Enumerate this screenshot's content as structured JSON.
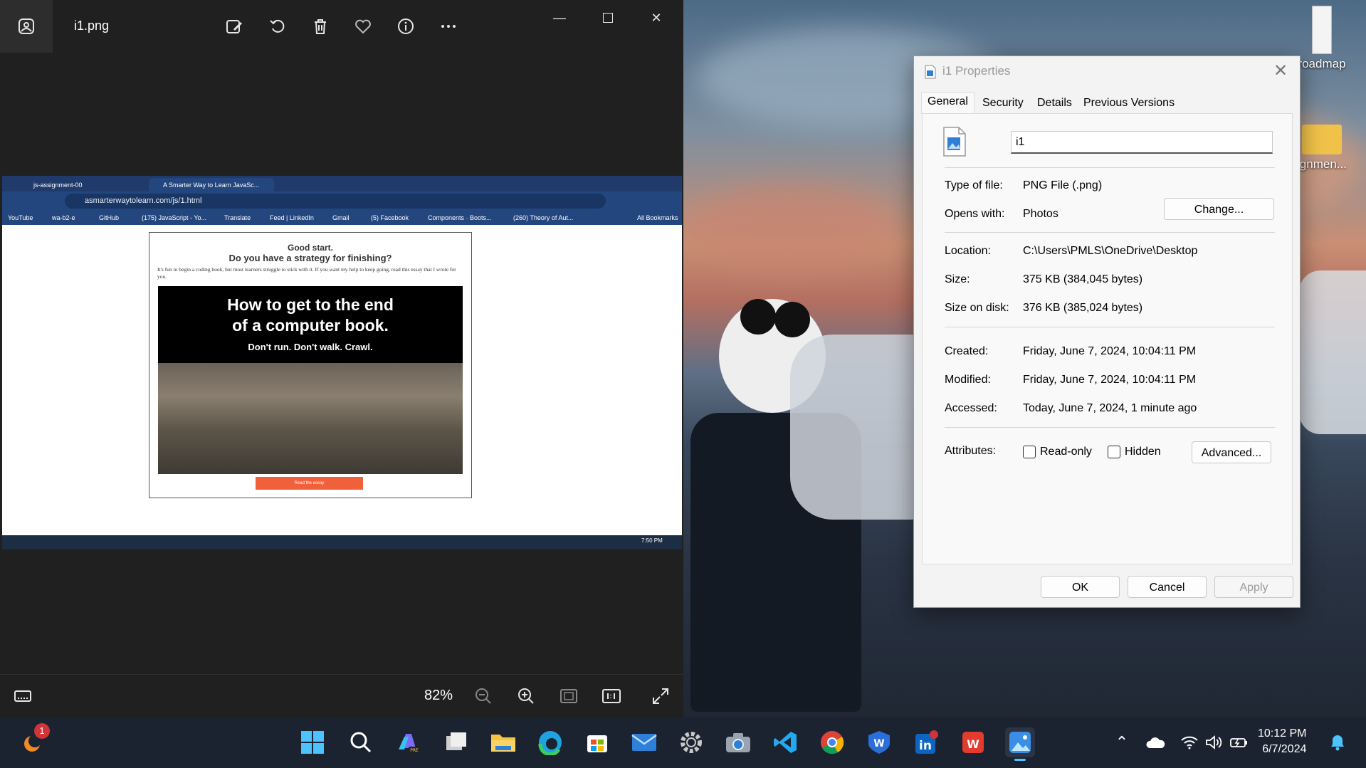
{
  "photos_window": {
    "filename": "i1.png",
    "zoom": "82%"
  },
  "inner_screenshot": {
    "tabs": [
      {
        "label": "js-assignment-00"
      },
      {
        "label": "A Smarter Way to Learn JavaSc..."
      }
    ],
    "url": "asmarterwaytolearn.com/js/1.html",
    "bookmarks": [
      "YouTube",
      "wa-b2-e",
      "GitHub",
      "(175) JavaScript - Yo...",
      "Translate",
      "Feed | LinkedIn",
      "Gmail",
      "(5) Facebook",
      "Components · Boots...",
      "(260) Theory of Aut..."
    ],
    "all_bookmarks": "All Bookmarks",
    "page": {
      "heading1": "Good start.",
      "heading2": "Do you have a strategy for finishing?",
      "paragraph": "It's fun to begin a coding book, but most learners struggle to stick with it. If you want my help to keep going, read this essay that I wrote for you.",
      "hero_title_line1": "How to get to the end",
      "hero_title_line2": "of a computer book.",
      "hero_subtitle": "Don't run. Don't walk. Crawl.",
      "button": "Read the essay"
    },
    "taskbar_time": "7:50 PM"
  },
  "properties_dialog": {
    "title": "i1 Properties",
    "tabs": [
      "General",
      "Security",
      "Details",
      "Previous Versions"
    ],
    "active_tab": "General",
    "name_value": "i1",
    "type_label": "Type of file:",
    "type_value": "PNG File (.png)",
    "opens_label": "Opens with:",
    "opens_value": "Photos",
    "change_button": "Change...",
    "location_label": "Location:",
    "location_value": "C:\\Users\\PMLS\\OneDrive\\Desktop",
    "size_label": "Size:",
    "size_value": "375 KB (384,045 bytes)",
    "size_disk_label": "Size on disk:",
    "size_disk_value": "376 KB (385,024 bytes)",
    "created_label": "Created:",
    "created_value": "Friday, June 7, 2024, 10:04:11 PM",
    "modified_label": "Modified:",
    "modified_value": "Friday, June 7, 2024, 10:04:11 PM",
    "accessed_label": "Accessed:",
    "accessed_value": "Today, June 7, 2024, 1 minute ago",
    "attributes_label": "Attributes:",
    "readonly_label": "Read-only",
    "hidden_label": "Hidden",
    "advanced_button": "Advanced...",
    "ok_button": "OK",
    "cancel_button": "Cancel",
    "apply_button": "Apply"
  },
  "desktop_icons": [
    {
      "label": "roadmap"
    },
    {
      "label": "ignmen..."
    }
  ],
  "taskbar": {
    "notification_badge": "1",
    "time": "10:12 PM",
    "date": "6/7/2024"
  },
  "colors": {
    "accent": "#0067c0",
    "photos_bg": "#202020",
    "dialog_bg": "#f3f3f3"
  }
}
